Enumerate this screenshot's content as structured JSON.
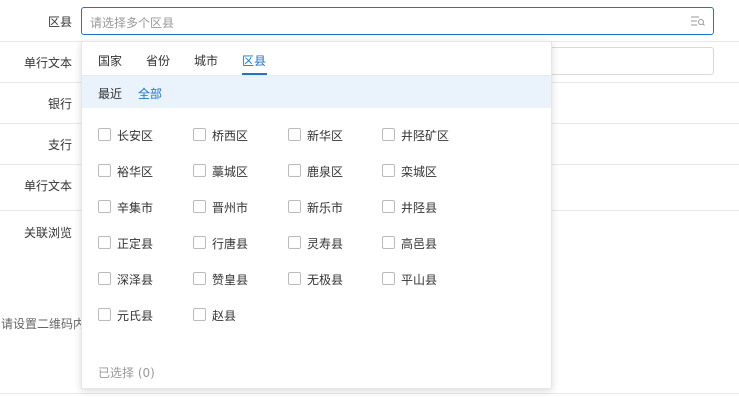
{
  "form": {
    "rows": [
      {
        "label": "区县"
      },
      {
        "label": "单行文本"
      },
      {
        "label": "银行"
      },
      {
        "label": "支行"
      },
      {
        "label": "单行文本"
      },
      {
        "label": "关联浏览"
      }
    ],
    "district_placeholder": "请选择多个区县",
    "qr_hint": "请设置二维码内"
  },
  "dropdown": {
    "tabs": [
      "国家",
      "省份",
      "城市",
      "区县"
    ],
    "active_tab": "区县",
    "subtabs": [
      "最近",
      "全部"
    ],
    "active_subtab": "全部",
    "options": [
      "长安区",
      "桥西区",
      "新华区",
      "井陉矿区",
      "裕华区",
      "藁城区",
      "鹿泉区",
      "栾城区",
      "辛集市",
      "晋州市",
      "新乐市",
      "井陉县",
      "正定县",
      "行唐县",
      "灵寿县",
      "高邑县",
      "深泽县",
      "赞皇县",
      "无极县",
      "平山县",
      "元氏县",
      "赵县"
    ],
    "selected_label": "已选择 (0)"
  },
  "colors": {
    "accent": "#1e74c7",
    "subbar_bg": "#eaf3fc"
  }
}
